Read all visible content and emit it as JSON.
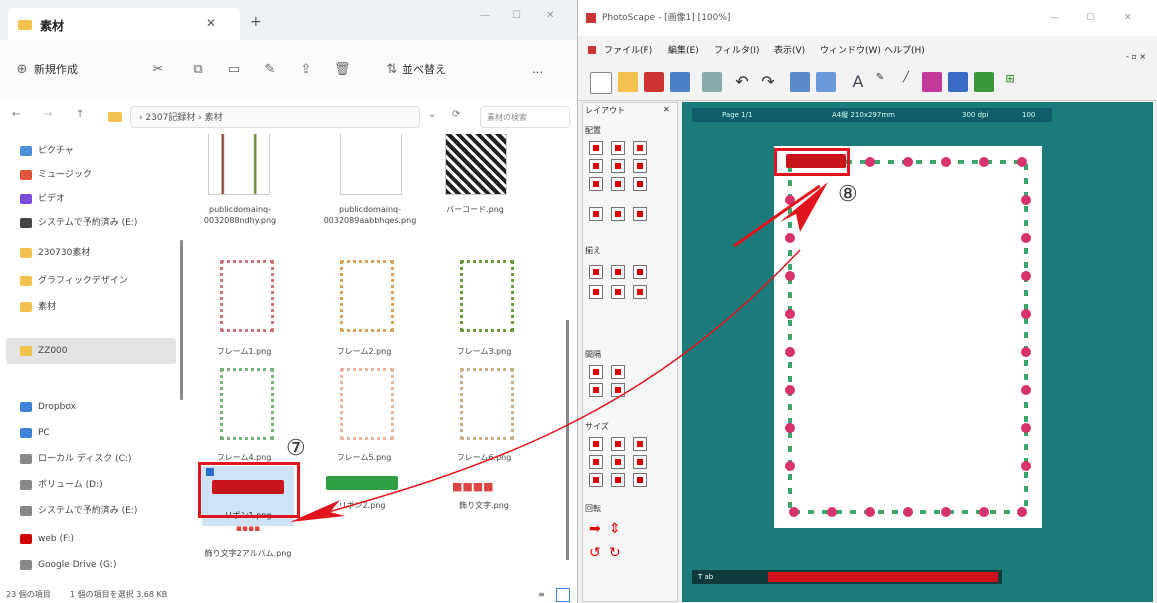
{
  "explorer": {
    "tab_title": "素材",
    "toolbar": {
      "new_label": "新規作成",
      "sort_label": "並べ替え",
      "more": "…"
    },
    "address": "› 2307記録材 › 素材",
    "search_placeholder": "素材の検索",
    "sidebar": [
      {
        "label": "ピクチャ",
        "color": "#4a90d9"
      },
      {
        "label": "ミュージック",
        "color": "#e2543d"
      },
      {
        "label": "ビデオ",
        "color": "#7a4ad9"
      },
      {
        "label": "システムで予約済み (E:)",
        "color": "#444444"
      },
      {
        "label": "230730素材",
        "color": "#f2c14e"
      },
      {
        "label": "グラフィックデザイン",
        "color": "#f2c14e"
      },
      {
        "label": "素材",
        "color": "#f2c14e"
      },
      {
        "label": "ZZ000",
        "color": "#f2c14e"
      },
      {
        "label": "Dropbox",
        "color": "#3d82d9"
      },
      {
        "label": "PC",
        "color": "#3d82d9"
      },
      {
        "label": "ローカル ディスク (C:)",
        "color": "#888888"
      },
      {
        "label": "ボリューム (D:)",
        "color": "#888888"
      },
      {
        "label": "システムで予約済み (E:)",
        "color": "#888888"
      },
      {
        "label": "web (F:)",
        "color": "#cc0000"
      },
      {
        "label": "Google Drive (G:)",
        "color": "#888888"
      }
    ],
    "files": [
      {
        "name": "publicdomainq-0032088ndhy.png"
      },
      {
        "name": "publicdomainq-0032089aabbhqes.png"
      },
      {
        "name": "バーコード.png"
      },
      {
        "name": "フレーム1.png"
      },
      {
        "name": "フレーム2.png"
      },
      {
        "name": "フレーム3.png"
      },
      {
        "name": "フレーム4.png"
      },
      {
        "name": "フレーム5.png"
      },
      {
        "name": "フレーム6.png"
      },
      {
        "name": "リボン1.png"
      },
      {
        "name": "リボン2.png"
      },
      {
        "name": "飾り文字.png"
      },
      {
        "name": "飾り文字2アルバム.png"
      }
    ],
    "status": {
      "items": "23 個の項目",
      "selected": "1 個の項目を選択 3.68 KB"
    }
  },
  "app": {
    "title": "PhotoScape - [画像1] [100%]",
    "menu": [
      "ファイル(F)",
      "編集(E)",
      "フィルタ(I)",
      "表示(V)",
      "ウィンドウ(W)",
      "ヘルプ(H)"
    ],
    "layout_pane": {
      "title": "レイアウト",
      "sections": [
        "配置",
        "揃え",
        "間隔",
        "サイズ",
        "回転"
      ]
    },
    "canvas_info": {
      "page": "Page 1/1",
      "size": "A4縦 210x297mm",
      "dpi": "300 dpi",
      "zoom": "100"
    },
    "bottom_label": "T ab"
  },
  "annotations": {
    "step7": "⑦",
    "step8": "⑧",
    "accent": "#e0141c"
  }
}
